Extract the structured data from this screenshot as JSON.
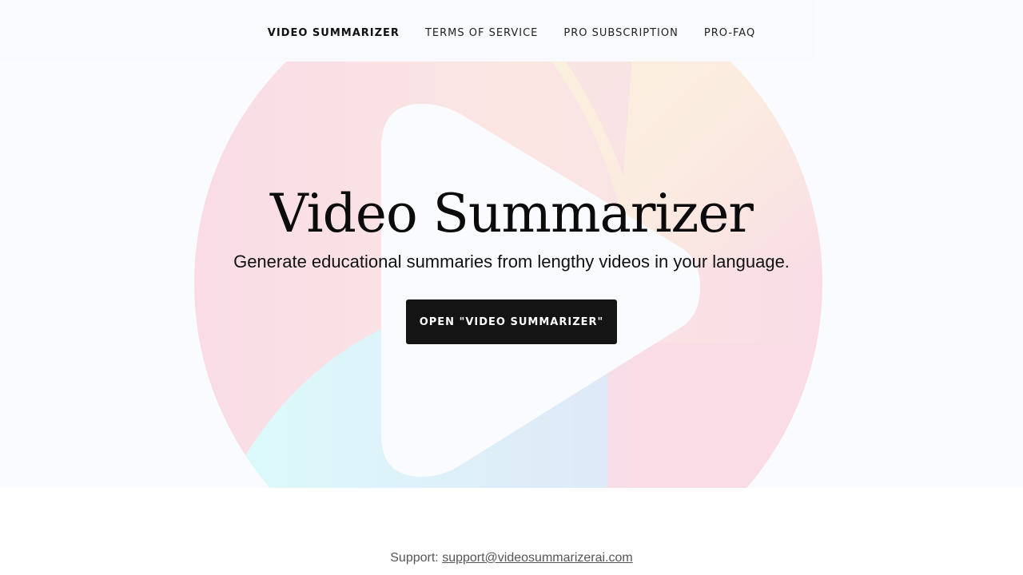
{
  "nav": {
    "items": [
      {
        "label": "VIDEO SUMMARIZER",
        "active": true
      },
      {
        "label": "TERMS OF SERVICE",
        "active": false
      },
      {
        "label": "PRO SUBSCRIPTION",
        "active": false
      },
      {
        "label": "PRO-FAQ",
        "active": false
      }
    ]
  },
  "hero": {
    "title": "Video Summarizer",
    "subtitle": "Generate educational summaries from lengthy videos in your language.",
    "cta_label": "OPEN \"VIDEO SUMMARIZER\"",
    "logo_icon": "play-circle-logo-icon",
    "colors": {
      "pink": "#f9dde8",
      "peach": "#fbe8e0",
      "yellow": "#faf1dc",
      "cyan": "#dcf8fb",
      "blue": "#dfeaf8",
      "background": "#fafbfe"
    }
  },
  "footer": {
    "label": "Support:",
    "email": "support@videosummarizerai.com"
  }
}
